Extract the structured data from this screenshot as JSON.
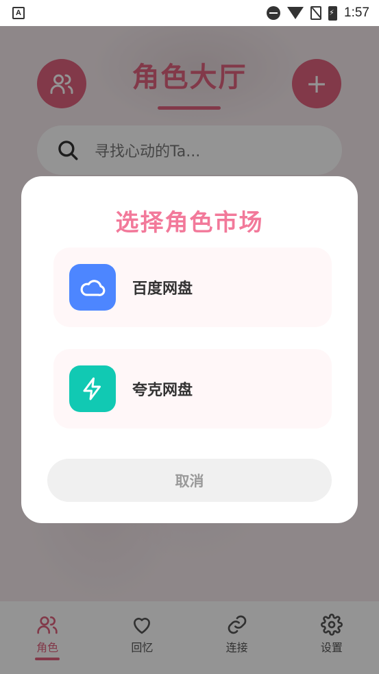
{
  "status_bar": {
    "left_icon_text": "A",
    "time": "1:57",
    "icons": [
      "dnd-icon",
      "wifi-icon",
      "no-sim-icon",
      "battery-charging-icon"
    ]
  },
  "header": {
    "title": "角色大厅",
    "left_button_icon": "users-icon",
    "right_button_icon": "plus-icon",
    "right_button_glyph": "+"
  },
  "search": {
    "placeholder": "寻找心动的Ta..."
  },
  "dialog": {
    "title": "选择角色市场",
    "options": [
      {
        "label": "百度网盘",
        "icon": "cloud-icon",
        "color": "#4d86ff"
      },
      {
        "label": "夸克网盘",
        "icon": "lightning-icon",
        "color": "#11c9b3"
      }
    ],
    "cancel_label": "取消"
  },
  "bottom_nav": {
    "items": [
      {
        "label": "角色",
        "icon": "users-icon",
        "active": true
      },
      {
        "label": "回忆",
        "icon": "heart-icon",
        "active": false
      },
      {
        "label": "连接",
        "icon": "link-icon",
        "active": false
      },
      {
        "label": "设置",
        "icon": "gear-icon",
        "active": false
      }
    ]
  },
  "colors": {
    "accent": "#e0627e",
    "dialog_title": "#f2799a",
    "overlay": "rgba(0,0,0,0.42)"
  }
}
